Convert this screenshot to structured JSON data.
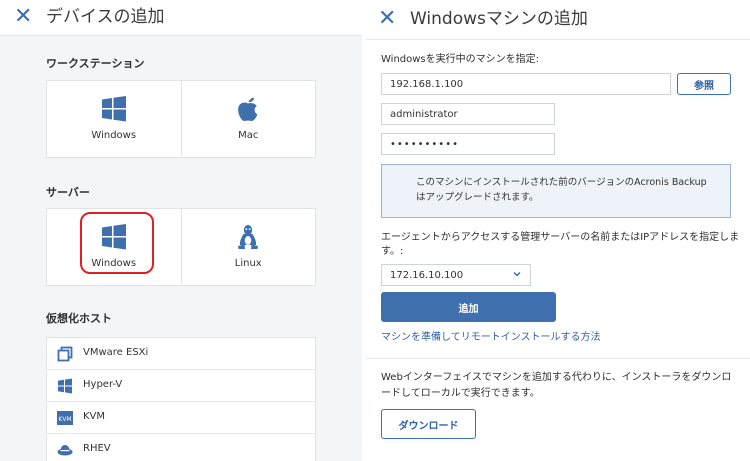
{
  "left": {
    "title": "デバイスの追加",
    "workstation": {
      "label": "ワークステーション",
      "items": [
        {
          "label": "Windows",
          "icon": "windows-icon"
        },
        {
          "label": "Mac",
          "icon": "apple-icon"
        }
      ]
    },
    "server": {
      "label": "サーバー",
      "items": [
        {
          "label": "Windows",
          "icon": "windows-icon"
        },
        {
          "label": "Linux",
          "icon": "linux-icon"
        }
      ]
    },
    "virtual_hosts": {
      "label": "仮想化ホスト",
      "items": [
        {
          "label": "VMware ESXi",
          "icon": "vmware-icon"
        },
        {
          "label": "Hyper-V",
          "icon": "hyperv-icon"
        },
        {
          "label": "KVM",
          "icon": "kvm-icon",
          "icon_text": "KVM"
        },
        {
          "label": "RHEV",
          "icon": "rhev-icon"
        }
      ]
    }
  },
  "right": {
    "title": "Windowsマシンの追加",
    "machine_label": "Windowsを実行中のマシンを指定:",
    "address_value": "192.168.1.100",
    "browse_label": "参照",
    "username_value": "administrator",
    "password_value": "••••••••••",
    "info_text": "このマシンにインストールされた前のバージョンのAcronis Backupはアップグレードされます。",
    "server_label": "エージェントからアクセスする管理サーバーの名前またはIPアドレスを指定します。:",
    "server_value": "172.16.10.100",
    "add_label": "追加",
    "help_link": "マシンを準備してリモートインストールする方法",
    "download_text": "Webインターフェイスでマシンを追加する代わりに、インストーラをダウンロードしてローカルで実行できます。",
    "download_label": "ダウンロード"
  },
  "colors": {
    "accent": "#3f6fad",
    "link": "#2f62a6",
    "highlight": "#e02020",
    "panel_bg": "#f4f5f7"
  }
}
